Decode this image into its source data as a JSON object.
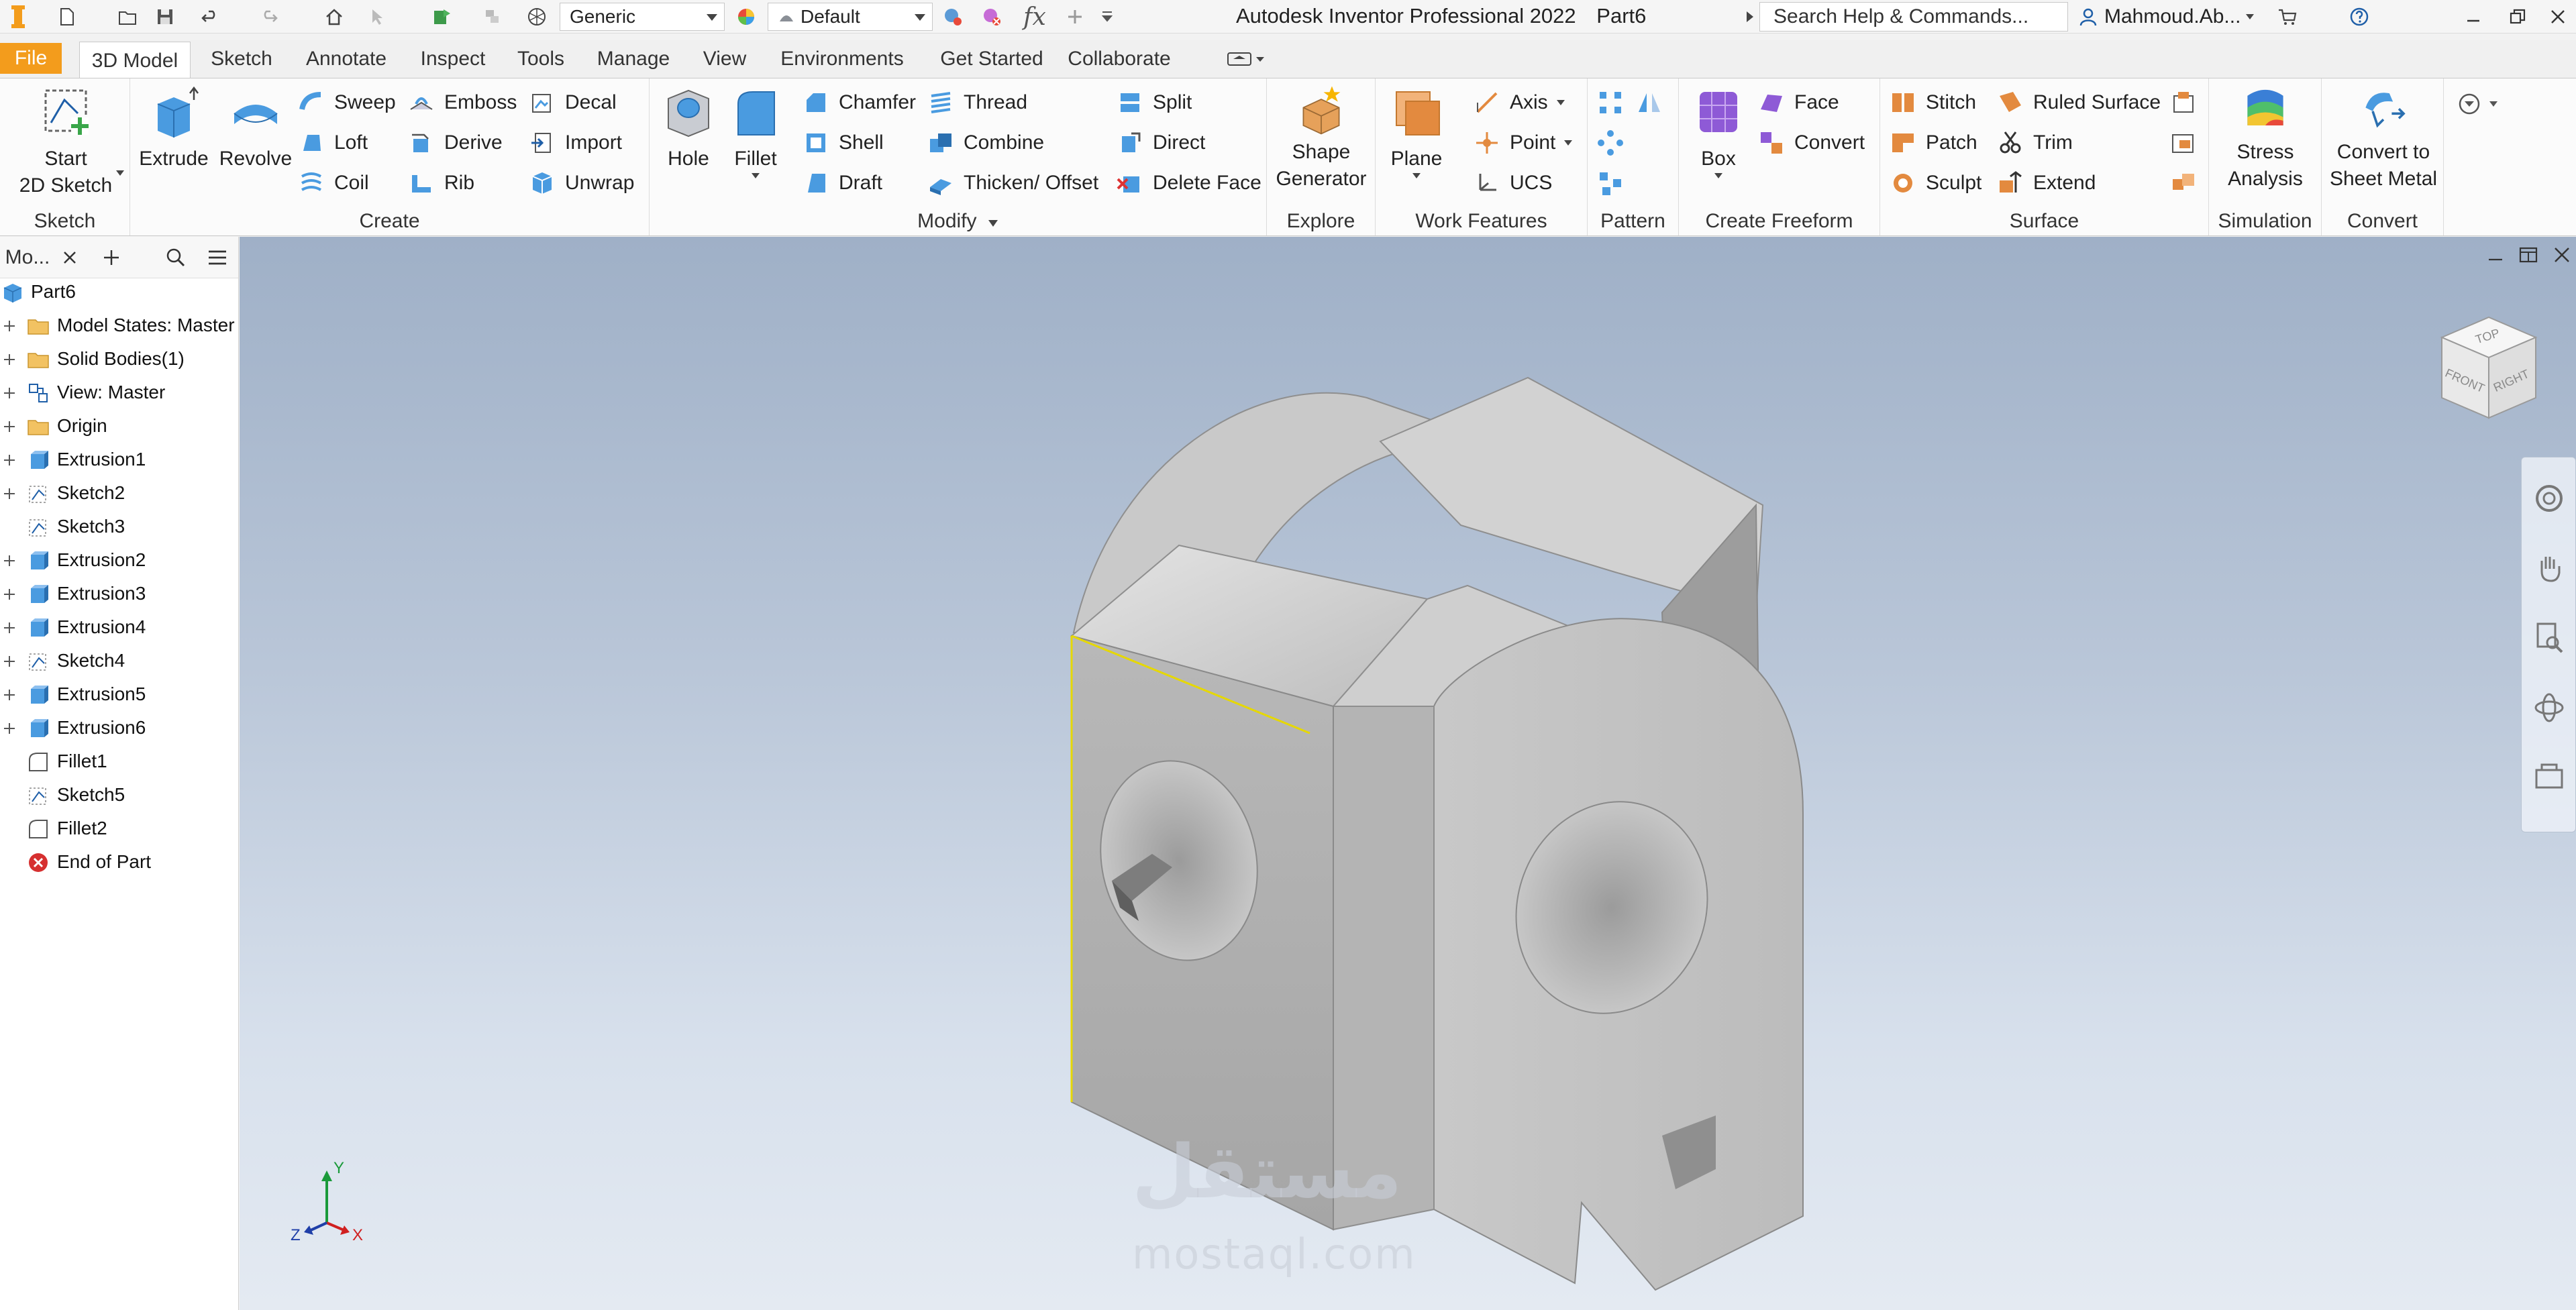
{
  "qat": {
    "material_value": "Generic",
    "appearance_value": "Default",
    "app_name": "Autodesk Inventor Professional 2022",
    "doc_name": "Part6",
    "search_placeholder": "Search Help & Commands...",
    "user_name": "Mahmoud.Ab...",
    "fx_label": "fx"
  },
  "tabs": [
    "File",
    "3D Model",
    "Sketch",
    "Annotate",
    "Inspect",
    "Tools",
    "Manage",
    "View",
    "Environments",
    "Get Started",
    "Collaborate"
  ],
  "ribbon": {
    "sketch": {
      "title": "Sketch",
      "start_label": "Start\n2D Sketch"
    },
    "create": {
      "title": "Create",
      "extrude": "Extrude",
      "revolve": "Revolve",
      "sweep": "Sweep",
      "loft": "Loft",
      "coil": "Coil",
      "emboss": "Emboss",
      "derive": "Derive",
      "rib": "Rib",
      "decal": "Decal",
      "import": "Import",
      "unwrap": "Unwrap"
    },
    "modify": {
      "title": "Modify",
      "hole": "Hole",
      "fillet": "Fillet",
      "chamfer": "Chamfer",
      "shell": "Shell",
      "draft": "Draft",
      "thread": "Thread",
      "combine": "Combine",
      "thicken": "Thicken/ Offset",
      "split": "Split",
      "direct": "Direct",
      "delete_face": "Delete Face"
    },
    "explore": {
      "title": "Explore",
      "shape_generator": "Shape\nGenerator"
    },
    "work_features": {
      "title": "Work Features",
      "plane": "Plane",
      "axis": "Axis",
      "point": "Point",
      "ucs": "UCS"
    },
    "pattern": {
      "title": "Pattern"
    },
    "freeform": {
      "title": "Create Freeform",
      "box": "Box",
      "face": "Face",
      "convert": "Convert"
    },
    "surface": {
      "title": "Surface",
      "stitch": "Stitch",
      "patch": "Patch",
      "sculpt": "Sculpt",
      "ruled_surface": "Ruled Surface",
      "trim": "Trim",
      "extend": "Extend"
    },
    "simulation": {
      "title": "Simulation",
      "stress": "Stress\nAnalysis"
    },
    "convert": {
      "title": "Convert",
      "sheet_metal": "Convert to\nSheet Metal"
    }
  },
  "browser": {
    "tab_label": "Mo...",
    "items": [
      {
        "label": "Part6",
        "icon": "part-icon"
      },
      {
        "label": "Model States: Master",
        "icon": "folder-icon"
      },
      {
        "label": "Solid Bodies(1)",
        "icon": "folder-icon"
      },
      {
        "label": "View: Master",
        "icon": "view-icon"
      },
      {
        "label": "Origin",
        "icon": "folder-icon"
      },
      {
        "label": "Extrusion1",
        "icon": "extrusion-icon"
      },
      {
        "label": "Sketch2",
        "icon": "sketch-icon"
      },
      {
        "label": "Sketch3",
        "icon": "sketch-icon"
      },
      {
        "label": "Extrusion2",
        "icon": "extrusion-icon"
      },
      {
        "label": "Extrusion3",
        "icon": "extrusion-icon"
      },
      {
        "label": "Extrusion4",
        "icon": "extrusion-icon"
      },
      {
        "label": "Sketch4",
        "icon": "sketch-icon"
      },
      {
        "label": "Extrusion5",
        "icon": "extrusion-icon"
      },
      {
        "label": "Extrusion6",
        "icon": "extrusion-icon"
      },
      {
        "label": "Fillet1",
        "icon": "fillet-icon"
      },
      {
        "label": "Sketch5",
        "icon": "sketch-icon"
      },
      {
        "label": "Fillet2",
        "icon": "fillet-icon"
      },
      {
        "label": "End of Part",
        "icon": "end-of-part-icon"
      }
    ]
  },
  "viewcube": {
    "top": "TOP",
    "front": "FRONT",
    "right": "RIGHT"
  },
  "triad": {
    "x": "X",
    "y": "Y",
    "z": "Z"
  },
  "watermark": {
    "arabic": "مستقل",
    "latin": "mostaql.com"
  }
}
